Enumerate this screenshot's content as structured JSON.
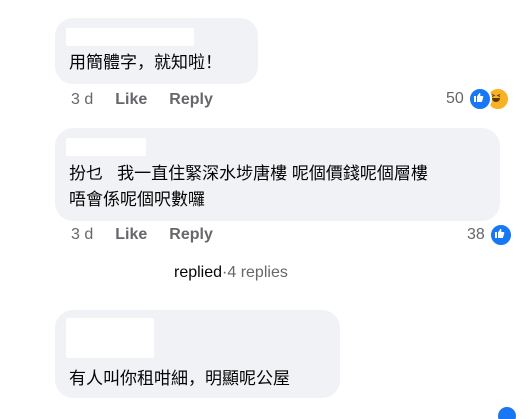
{
  "comments": [
    {
      "text": "用簡體字，就知啦！",
      "age": "3 d",
      "like_label": "Like",
      "reply_label": "Reply",
      "reaction_count": "50",
      "reaction_icons": [
        "like-icon",
        "haha-icon"
      ]
    },
    {
      "text_line1": "扮乜   我一直住緊深水埗唐樓 呢個價錢呢個層樓",
      "text_line2": "唔會係呢個呎數囉",
      "age": "3 d",
      "like_label": "Like",
      "reply_label": "Reply",
      "reaction_count": "38",
      "reaction_icons": [
        "like-icon"
      ]
    },
    {
      "text": "有人叫你租咁細，明顯呢公屋"
    }
  ],
  "replies": {
    "verb": "replied",
    "separator": " · ",
    "count_text": "4 replies"
  },
  "colors": {
    "bubble": "#f0f2f5",
    "text": "#050505",
    "meta": "#65676b",
    "like_blue": "#1877f2",
    "haha_yellow": "#f7b125"
  }
}
